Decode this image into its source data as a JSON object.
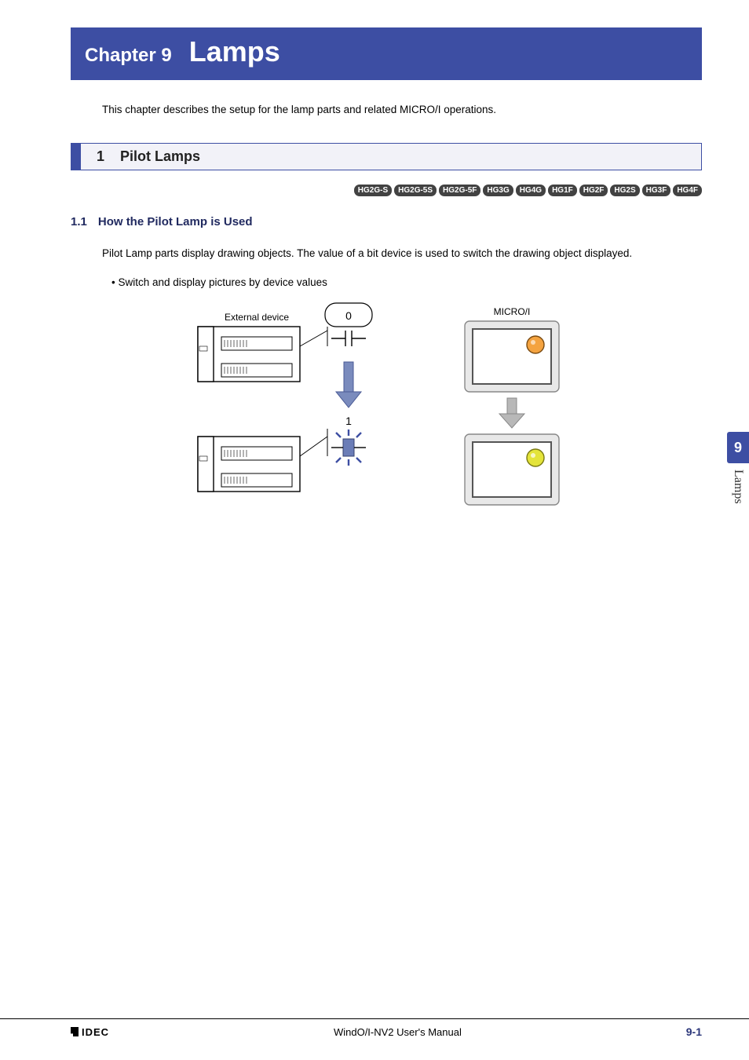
{
  "chapter": {
    "label": "Chapter 9",
    "title": "Lamps"
  },
  "intro": "This chapter describes the setup for the lamp parts and related MICRO/I operations.",
  "section": {
    "number": "1",
    "title": "Pilot Lamps"
  },
  "model_tags": [
    "HG2G-S",
    "HG2G-5S",
    "HG2G-5F",
    "HG3G",
    "HG4G",
    "HG1F",
    "HG2F",
    "HG2S",
    "HG3F",
    "HG4F"
  ],
  "subsection": {
    "number": "1.1",
    "title": "How the Pilot Lamp is Used"
  },
  "body1": "Pilot Lamp parts display drawing objects. The value of a bit device is used to switch the drawing object displayed.",
  "bullet1": "Switch and display pictures by device values",
  "diagram": {
    "external_device_label": "External device",
    "microi_label": "MICRO/I",
    "state0": "0",
    "state1": "1"
  },
  "side_tab": {
    "number": "9",
    "label": "Lamps"
  },
  "footer": {
    "logo": "IDEC",
    "manual": "WindO/I-NV2 User's Manual",
    "page": "9-1"
  }
}
